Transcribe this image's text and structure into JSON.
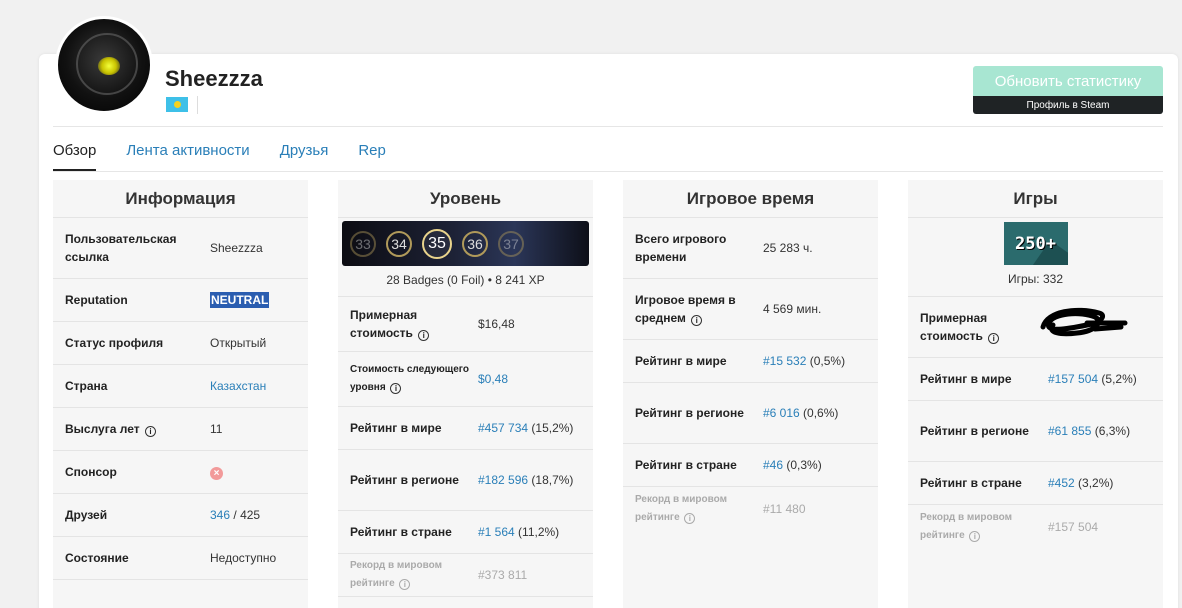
{
  "profile": {
    "username": "Sheezzza",
    "update_button": "Обновить статистику",
    "steam_link": "Профиль в Steam"
  },
  "tabs": [
    {
      "label": "Обзор",
      "active": true
    },
    {
      "label": "Лента активности",
      "active": false
    },
    {
      "label": "Друзья",
      "active": false
    },
    {
      "label": "Rep",
      "active": false
    }
  ],
  "info": {
    "title": "Информация",
    "custom_url_label": "Пользовательская ссылка",
    "custom_url_value": "Sheezzza",
    "reputation_label": "Reputation",
    "reputation_value": "NEUTRAL",
    "status_label": "Статус профиля",
    "status_value": "Открытый",
    "country_label": "Страна",
    "country_value": "Казахстан",
    "years_label": "Выслуга лет",
    "years_value": "11",
    "sponsor_label": "Спонсор",
    "friends_label": "Друзей",
    "friends_count": "346",
    "friends_sep": "/",
    "friends_total": "425",
    "state_label": "Состояние",
    "state_value": "Недоступно"
  },
  "level": {
    "title": "Уровень",
    "levels": [
      "33",
      "34",
      "35",
      "36",
      "37"
    ],
    "current": "35",
    "badges_line": "28 Badges (0 Foil) • 8 241 XP",
    "cost_label": "Примерная стоимость",
    "cost_value": "$16,48",
    "next_cost_label": "Стоимость следующего уровня",
    "next_cost_value": "$0,48",
    "world_label": "Рейтинг в мире",
    "world_rank": "#457 734",
    "world_pct": "(15,2%)",
    "region_label": "Рейтинг в регионе",
    "region_rank": "#182 596",
    "region_pct": "(18,7%)",
    "country_label": "Рейтинг в стране",
    "country_rank": "#1 564",
    "country_pct": "(11,2%)",
    "record_label": "Рекорд в мировом рейтинге",
    "record_value": "#373 811"
  },
  "playtime": {
    "title": "Игровое время",
    "total_label": "Всего игрового времени",
    "total_value": "25 283 ч.",
    "avg_label": "Игровое время в среднем",
    "avg_value": "4 569 мин.",
    "world_label": "Рейтинг в мире",
    "world_rank": "#15 532",
    "world_pct": "(0,5%)",
    "region_label": "Рейтинг в регионе",
    "region_rank": "#6 016",
    "region_pct": "(0,6%)",
    "country_label": "Рейтинг в стране",
    "country_rank": "#46",
    "country_pct": "(0,3%)",
    "record_label": "Рекорд в мировом рейтинге",
    "record_value": "#11 480"
  },
  "games": {
    "title": "Игры",
    "icon_text": "250+",
    "count_line": "Игры: 332",
    "cost_label": "Примерная стоимость",
    "world_label": "Рейтинг в мире",
    "world_rank": "#157 504",
    "world_pct": "(5,2%)",
    "region_label": "Рейтинг в регионе",
    "region_rank": "#61 855",
    "region_pct": "(6,3%)",
    "country_label": "Рейтинг в стране",
    "country_rank": "#452",
    "country_pct": "(3,2%)",
    "record_label": "Рекорд в мировом рейтинге",
    "record_value": "#157 504"
  },
  "colors": {
    "link": "#2a7fb8",
    "update_button": "#a8e6d2",
    "steam_bar": "#1f2325",
    "neutral_highlight": "#2a5db0"
  }
}
